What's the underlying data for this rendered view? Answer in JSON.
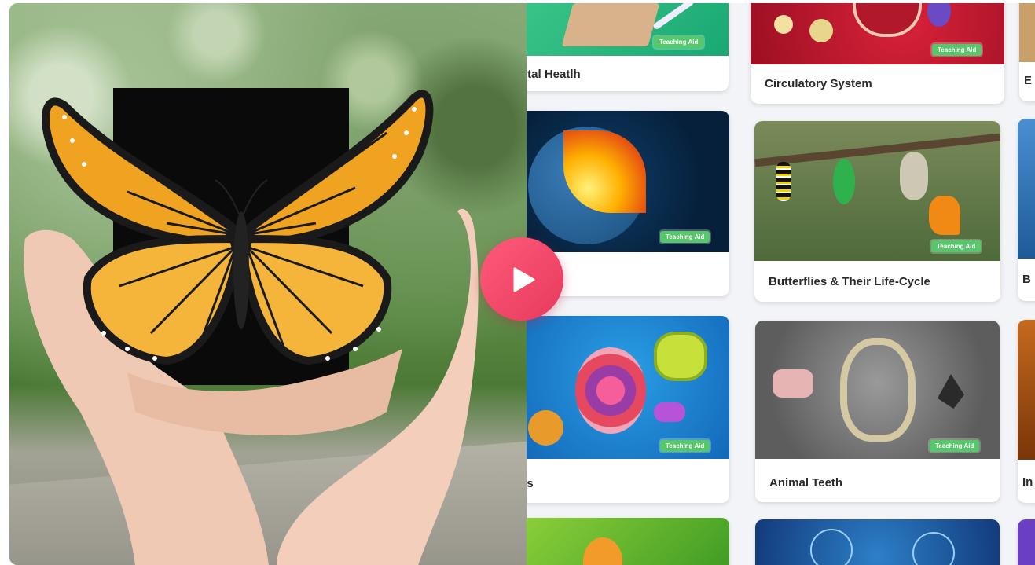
{
  "player": {
    "play_icon": "play-icon",
    "accent_color": "#ee4466"
  },
  "cards": {
    "badge_label": "Teaching Aid",
    "row1": [
      {
        "title": "ntal Heatlh"
      },
      {
        "title": "Circulatory System"
      },
      {
        "title": "E"
      }
    ],
    "row2": [
      {
        "title": ""
      },
      {
        "title": "Butterflies & Their Life-Cycle"
      },
      {
        "title": "B"
      }
    ],
    "row3": [
      {
        "title": "lls"
      },
      {
        "title": "Animal Teeth"
      },
      {
        "title": "In"
      }
    ]
  }
}
